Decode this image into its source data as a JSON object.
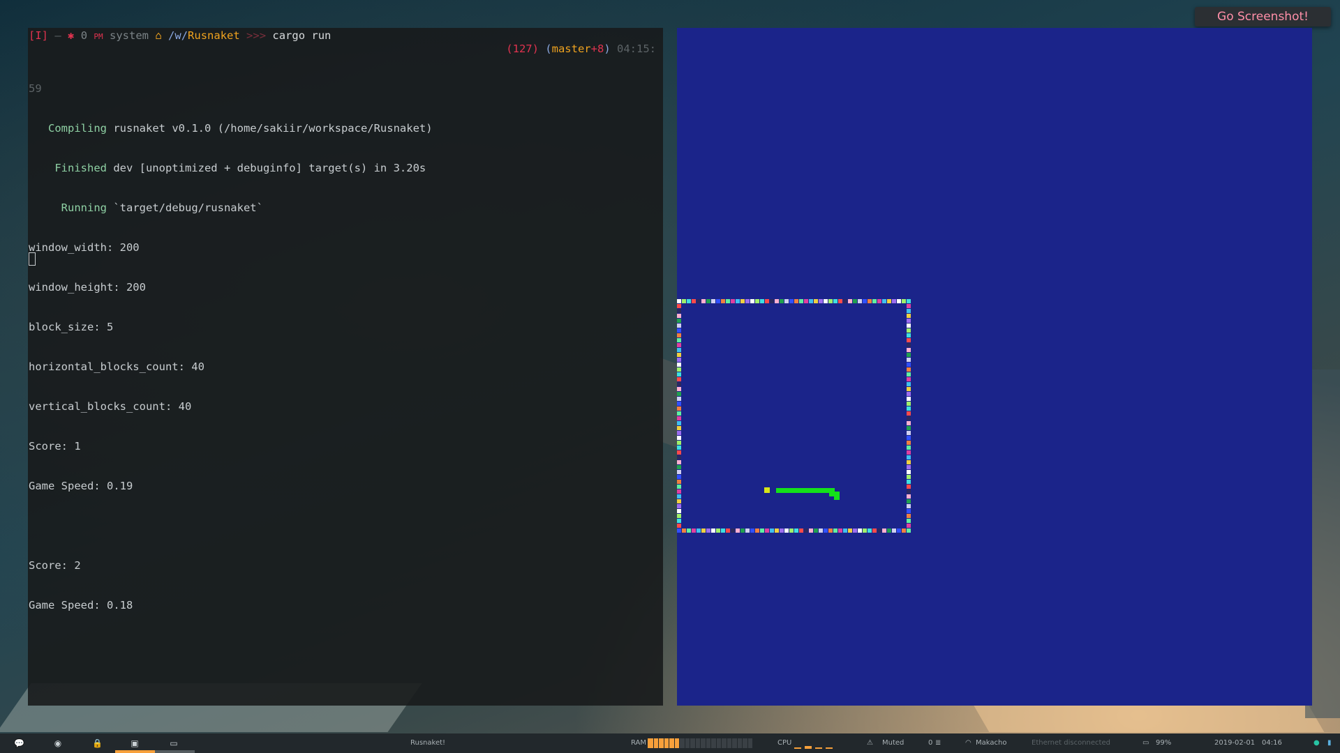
{
  "notification": {
    "text": "Go Screenshot!"
  },
  "terminal": {
    "prompt": {
      "bracket": "[I]",
      "dash": "–",
      "gear": "✱",
      "zero": "0",
      "pm": "PM",
      "env": "system",
      "home_icon": "home-icon",
      "path_prefix": "/w/",
      "path_dir": "Rusnaket",
      "arrows": ">>>",
      "command": "cargo run"
    },
    "right_prompt": {
      "exit_code": "(127)",
      "branch_open": "(",
      "branch": "master",
      "branch_mod": "+8",
      "branch_close": ")",
      "time": "04:15:"
    },
    "output": {
      "line_number": "59",
      "compiling_kw": "Compiling",
      "compiling_rest": " rusnaket v0.1.0 (/home/sakiir/workspace/Rusnaket)",
      "finished_kw": "Finished",
      "finished_rest": " dev [unoptimized + debuginfo] target(s) in 3.20s",
      "running_kw": "Running",
      "running_rest": " `target/debug/rusnaket`",
      "lines": [
        "window_width: 200",
        "window_height: 200",
        "block_size: 5",
        "horizontal_blocks_count: 40",
        "vertical_blocks_count: 40",
        "Score: 1",
        "Game Speed: 0.19",
        "",
        "Score: 2",
        "Game Speed: 0.18"
      ]
    }
  },
  "game": {
    "title": "Rusnaket!",
    "background": "#1b248a",
    "snake_color": "#14e21a",
    "food_color": "#d7e619"
  },
  "taskbar": {
    "icons": [
      "chat-icon",
      "chrome-icon",
      "lock-icon",
      "terminal-icon",
      "monitor-icon"
    ],
    "window_title": "Rusnaket!",
    "ram_label": "RAM",
    "ram_used_fraction": 0.3,
    "cpu_label": "CPU",
    "volume": "Muted",
    "db_count": "0",
    "wifi": "Makacho",
    "ethernet": "Ethernet disconnected",
    "battery": "99%",
    "date": "2019-02-01",
    "time": "04:16",
    "accent": "#f7a03b"
  }
}
